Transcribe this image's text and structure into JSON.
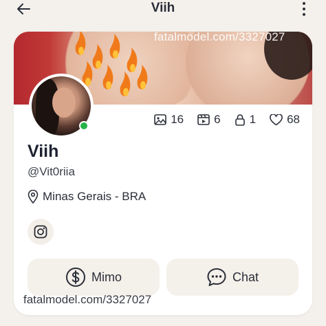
{
  "header": {
    "title": "Viih",
    "back_icon": "arrow-left-icon",
    "menu_icon": "more-vertical-icon"
  },
  "cover": {
    "watermark": "fatalmodel.com/3327027"
  },
  "profile": {
    "name": "Viih",
    "handle": "@Vit0riia",
    "location": "Minas Gerais - BRA",
    "online_color": "#27b24a"
  },
  "stats": {
    "photos": "16",
    "videos": "6",
    "locked": "1",
    "likes": "68"
  },
  "actions": {
    "mimo_label": "Mimo",
    "chat_label": "Chat"
  },
  "footer": {
    "watermark": "fatalmodel.com/3327027"
  }
}
